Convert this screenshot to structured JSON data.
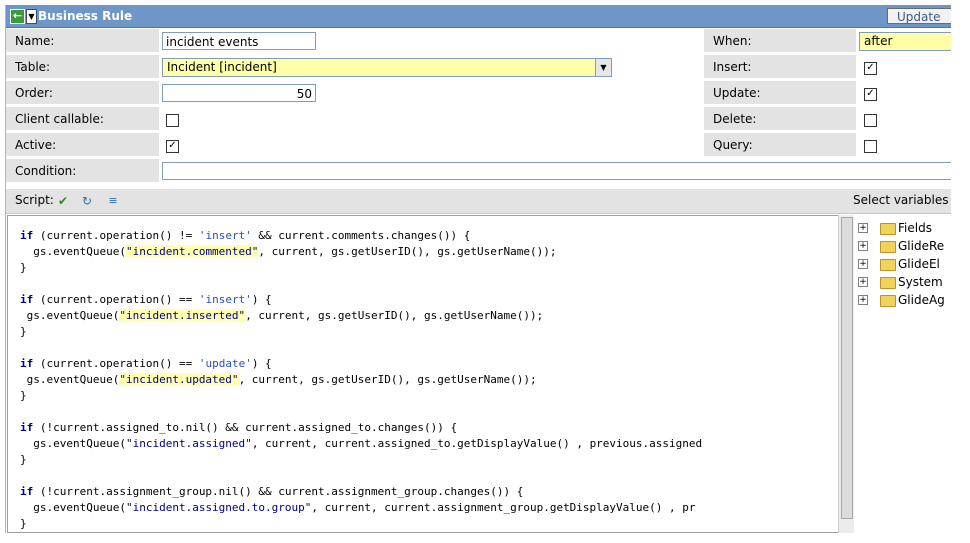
{
  "header": {
    "title": "Business Rule",
    "update_label": "Update"
  },
  "form": {
    "name": {
      "label": "Name:",
      "value": "incident events"
    },
    "table": {
      "label": "Table:",
      "value": "Incident [incident]"
    },
    "order": {
      "label": "Order:",
      "value": "50"
    },
    "client_callable": {
      "label": "Client callable:",
      "checked": false
    },
    "active": {
      "label": "Active:",
      "checked": true
    },
    "condition": {
      "label": "Condition:",
      "value": ""
    },
    "when": {
      "label": "When:",
      "value": "after"
    },
    "insert": {
      "label": "Insert:",
      "checked": true
    },
    "update": {
      "label": "Update:",
      "checked": true
    },
    "delete": {
      "label": "Delete:",
      "checked": false
    },
    "query": {
      "label": "Query:",
      "checked": false
    }
  },
  "script": {
    "label": "Script:",
    "icons": [
      "check-syntax-icon",
      "toggle-syntax-icon",
      "script-tree-icon"
    ],
    "lines": [
      "if (current.operation() != 'insert' && current.comments.changes()) {",
      "  gs.eventQueue(\"incident.commented\", current, gs.getUserID(), gs.getUserName());",
      "}",
      "",
      "if (current.operation() == 'insert') {",
      " gs.eventQueue(\"incident.inserted\", current, gs.getUserID(), gs.getUserName());",
      "}",
      "",
      "if (current.operation() == 'update') {",
      " gs.eventQueue(\"incident.updated\", current, gs.getUserID(), gs.getUserName());",
      "}",
      "",
      "if (!current.assigned_to.nil() && current.assigned_to.changes()) {",
      "  gs.eventQueue(\"incident.assigned\", current, current.assigned_to.getDisplayValue() , previous.assigned",
      "}",
      "",
      "if (!current.assignment_group.nil() && current.assignment_group.changes()) {",
      "  gs.eventQueue(\"incident.assigned.to.group\", current, current.assignment_group.getDisplayValue() , pr",
      "}"
    ]
  },
  "variables": {
    "label": "Select variables",
    "items": [
      "Fields",
      "GlideRe",
      "GlideEl",
      "System",
      "GlideAg"
    ]
  }
}
